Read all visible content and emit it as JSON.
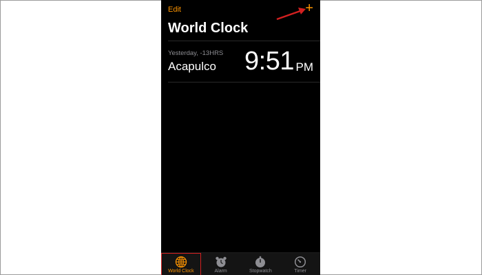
{
  "header": {
    "edit_label": "Edit",
    "add_icon": "plus-icon",
    "title": "World Clock"
  },
  "clocks": [
    {
      "offset": "Yesterday, -13HRS",
      "city": "Acapulco",
      "time": "9:51",
      "ampm": "PM"
    }
  ],
  "tabbar": {
    "tabs": [
      {
        "label": "World Clock",
        "icon": "globe-icon",
        "active": true
      },
      {
        "label": "Alarm",
        "icon": "alarm-clock-icon",
        "active": false
      },
      {
        "label": "Stopwatch",
        "icon": "stopwatch-icon",
        "active": false
      },
      {
        "label": "Timer",
        "icon": "timer-icon",
        "active": false
      }
    ]
  },
  "colors": {
    "accent": "#ff9500",
    "background": "#000000",
    "annotation": "#d32020"
  }
}
